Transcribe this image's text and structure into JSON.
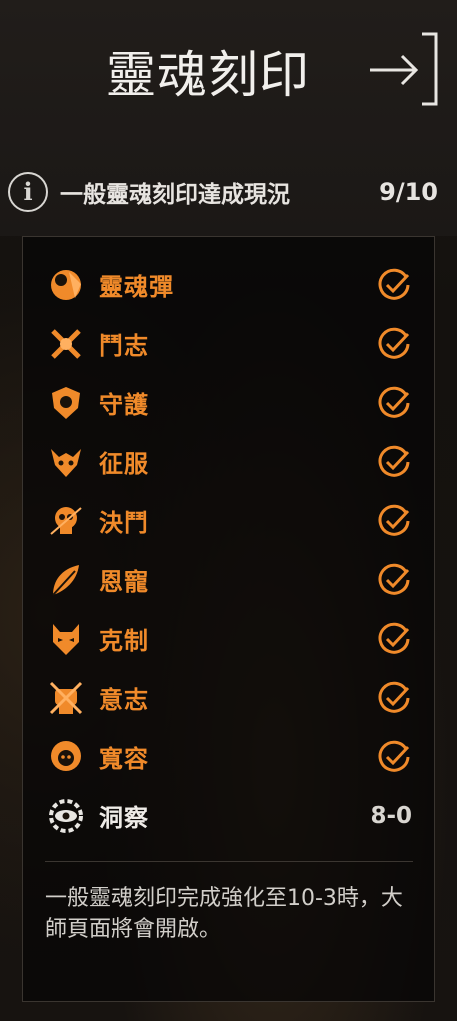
{
  "header": {
    "title": "靈魂刻印",
    "exit_icon": "exit-arrow-icon"
  },
  "status": {
    "label": "一般靈魂刻印達成現況",
    "count": "9/10",
    "info_icon": "info-icon"
  },
  "items": [
    {
      "label": "靈魂彈",
      "icon": "soul-bullet-icon",
      "completed": true
    },
    {
      "label": "鬥志",
      "icon": "crossed-swords-icon",
      "completed": true
    },
    {
      "label": "守護",
      "icon": "shield-crest-icon",
      "completed": true
    },
    {
      "label": "征服",
      "icon": "horned-beast-icon",
      "completed": true
    },
    {
      "label": "決鬥",
      "icon": "skull-icon",
      "completed": true
    },
    {
      "label": "恩寵",
      "icon": "feather-icon",
      "completed": true
    },
    {
      "label": "克制",
      "icon": "demon-mask-icon",
      "completed": true
    },
    {
      "label": "意志",
      "icon": "fist-icon",
      "completed": true
    },
    {
      "label": "寬容",
      "icon": "lion-head-icon",
      "completed": true
    },
    {
      "label": "洞察",
      "icon": "eye-gear-icon",
      "completed": false,
      "progress": "8-0"
    }
  ],
  "description": "一般靈魂刻印完成強化至10-3時，大師頁面將會開啟。",
  "colors": {
    "accent": "#f08a2a",
    "text": "#efece8",
    "panel": "#080706"
  }
}
